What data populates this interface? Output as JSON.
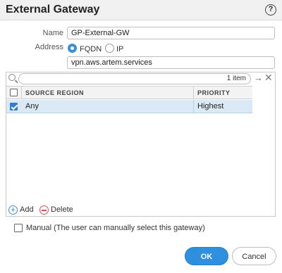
{
  "dialog": {
    "title": "External Gateway",
    "help_glyph": "?"
  },
  "form": {
    "name_label": "Name",
    "name_value": "GP-External-GW",
    "address_label": "Address",
    "address_options": [
      "FQDN",
      "IP"
    ],
    "address_selected": "FQDN",
    "address_value": "vpn.aws.artem.services"
  },
  "grid": {
    "count": "1 item",
    "columns": [
      "SOURCE REGION",
      "PRIORITY"
    ],
    "rows": [
      {
        "checked": true,
        "source_region": "Any",
        "priority": "Highest"
      }
    ],
    "add_label": "Add",
    "delete_label": "Delete"
  },
  "manual_label": "Manual (The user can manually select this gateway)",
  "manual_checked": false,
  "buttons": {
    "ok": "OK",
    "cancel": "Cancel"
  },
  "colors": {
    "accent": "#2f8fdf",
    "selected_row": "#dbe9f6",
    "delete": "#d9534f"
  },
  "icons": [
    "help-icon",
    "search-icon",
    "arrow-right-icon",
    "close-icon",
    "add-icon",
    "delete-icon"
  ]
}
